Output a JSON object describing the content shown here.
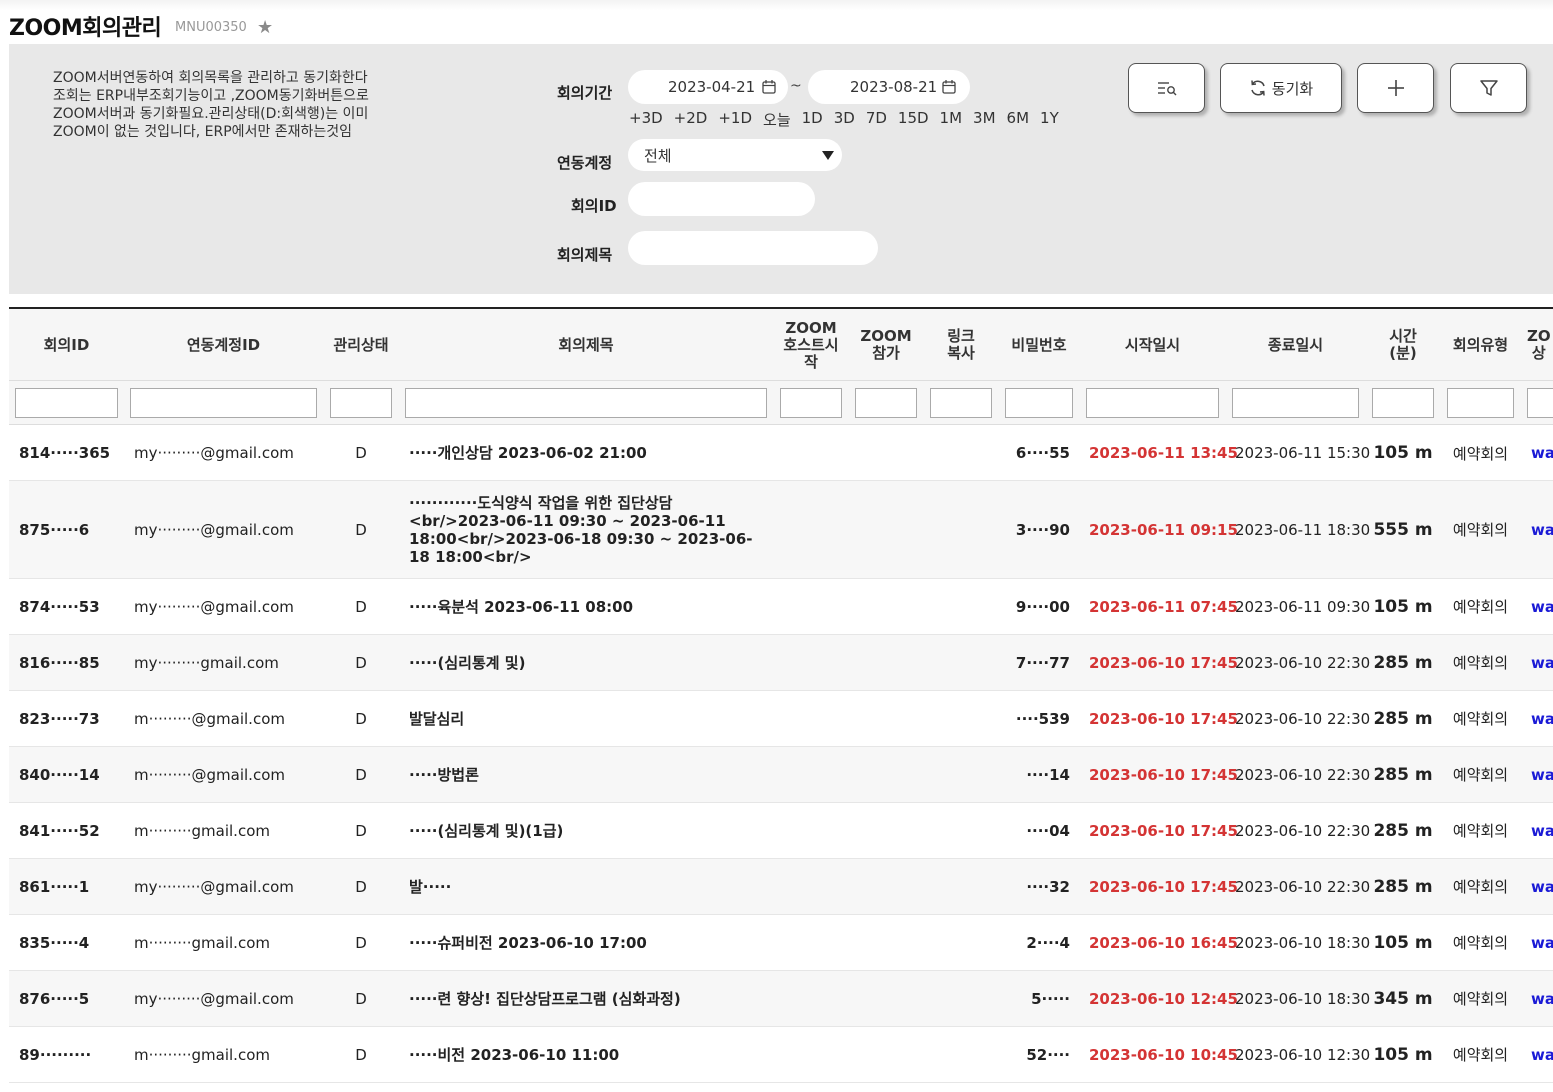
{
  "header": {
    "title": "ZOOM회의관리",
    "menu_code": "MNU00350"
  },
  "description": [
    "ZOOM서버연동하여 회의목록을 관리하고 동기화한다",
    "조회는 ERP내부조회기능이고 ,ZOOM동기화버튼으로",
    "ZOOM서버과 동기화필요.관리상태(D:회색행)는 이미",
    "ZOOM이 없는 것입니다, ERP에서만 존재하는것임"
  ],
  "search": {
    "period_label": "회의기간",
    "date_from": "2023-04-21",
    "date_to": "2023-08-21",
    "tilde": "~",
    "quick_ranges": [
      "+3D",
      "+2D",
      "+1D",
      "오늘",
      "1D",
      "3D",
      "7D",
      "15D",
      "1M",
      "3M",
      "6M",
      "1Y"
    ],
    "account_label": "연동계정",
    "account_value": "전체",
    "meeting_id_label": "회의ID",
    "meeting_title_label": "회의제목"
  },
  "toolbar": {
    "sync_label": "동기화"
  },
  "columns": [
    "회의ID",
    "연동계정ID",
    "관리상태",
    "회의제목",
    "ZOOM\n호스트시\n작",
    "ZOOM\n참가",
    "링크\n복사",
    "비밀번호",
    "시작일시",
    "종료일시",
    "시간\n(분)",
    "회의유형",
    "ZO\n상"
  ],
  "rows": [
    {
      "id": "814·····365",
      "account": "my·········@gmail.com",
      "status": "D",
      "title": "·····개인상담 2023-06-02 21:00",
      "password": "6····55",
      "start": "2023-06-11 13:45",
      "end": "2023-06-11 15:30",
      "minutes": "105 m",
      "type": "예약회의",
      "link": "wai"
    },
    {
      "id": "875·····6",
      "account": "my·········@gmail.com",
      "status": "D",
      "title": "············도식양식 작업을 위한 집단상담 <br/>2023-06-11 09:30 ~ 2023-06-11 18:00<br/>2023-06-18 09:30 ~ 2023-06-18 18:00<br/>",
      "password": "3····90",
      "start": "2023-06-11 09:15",
      "end": "2023-06-11 18:30",
      "minutes": "555 m",
      "type": "예약회의",
      "link": "wai"
    },
    {
      "id": "874·····53",
      "account": "my·········@gmail.com",
      "status": "D",
      "title": "·····육분석 2023-06-11 08:00",
      "password": "9····00",
      "start": "2023-06-11 07:45",
      "end": "2023-06-11 09:30",
      "minutes": "105 m",
      "type": "예약회의",
      "link": "wai"
    },
    {
      "id": "816·····85",
      "account": "my·········gmail.com",
      "status": "D",
      "title": "·····(심리통계 및)",
      "password": "7····77",
      "start": "2023-06-10 17:45",
      "end": "2023-06-10 22:30",
      "minutes": "285 m",
      "type": "예약회의",
      "link": "wai"
    },
    {
      "id": "823·····73",
      "account": "m·········@gmail.com",
      "status": "D",
      "title": "발달심리",
      "password": "····539",
      "start": "2023-06-10 17:45",
      "end": "2023-06-10 22:30",
      "minutes": "285 m",
      "type": "예약회의",
      "link": "wai"
    },
    {
      "id": "840·····14",
      "account": "m·········@gmail.com",
      "status": "D",
      "title": "·····방법론",
      "password": "····14",
      "start": "2023-06-10 17:45",
      "end": "2023-06-10 22:30",
      "minutes": "285 m",
      "type": "예약회의",
      "link": "wai"
    },
    {
      "id": "841·····52",
      "account": "m·········gmail.com",
      "status": "D",
      "title": "·····(심리통계 및)(1급)",
      "password": "····04",
      "start": "2023-06-10 17:45",
      "end": "2023-06-10 22:30",
      "minutes": "285 m",
      "type": "예약회의",
      "link": "wai"
    },
    {
      "id": "861·····1",
      "account": "my·········@gmail.com",
      "status": "D",
      "title": "발·····",
      "password": "····32",
      "start": "2023-06-10 17:45",
      "end": "2023-06-10 22:30",
      "minutes": "285 m",
      "type": "예약회의",
      "link": "wai"
    },
    {
      "id": "835·····4",
      "account": "m·········gmail.com",
      "status": "D",
      "title": "·····슈퍼비전 2023-06-10 17:00",
      "password": "2····4",
      "start": "2023-06-10 16:45",
      "end": "2023-06-10 18:30",
      "minutes": "105 m",
      "type": "예약회의",
      "link": "wai"
    },
    {
      "id": "876·····5",
      "account": "my·········@gmail.com",
      "status": "D",
      "title": "·····련 향상! 집단상담프로그램 (심화과정)",
      "password": "5·····",
      "start": "2023-06-10 12:45",
      "end": "2023-06-10 18:30",
      "minutes": "345 m",
      "type": "예약회의",
      "link": "wai"
    },
    {
      "id": "89·········",
      "account": "m·········gmail.com",
      "status": "D",
      "title": "·····비전 2023-06-10 11:00",
      "password": "52····",
      "start": "2023-06-10 10:45",
      "end": "2023-06-10 12:30",
      "minutes": "105 m",
      "type": "예약회의",
      "link": "wai"
    }
  ]
}
